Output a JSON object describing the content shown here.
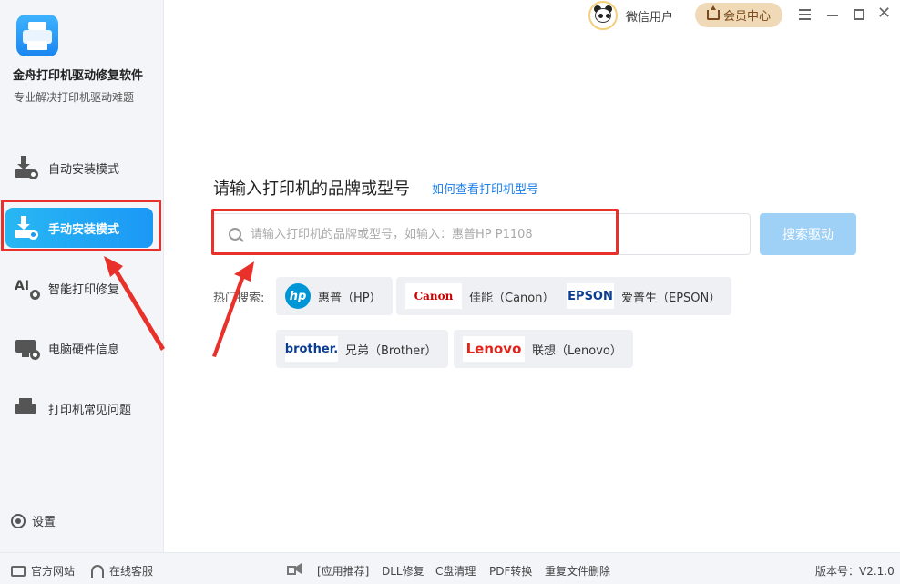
{
  "app": {
    "name": "金舟打印机驱动修复软件",
    "subtitle": "专业解决打印机驱动难题"
  },
  "sidebar": {
    "items": [
      {
        "label": "自动安装模式",
        "icon": "auto-install-icon",
        "active": false
      },
      {
        "label": "手动安装模式",
        "icon": "manual-install-icon",
        "active": true
      },
      {
        "label": "智能打印修复",
        "icon": "ai-repair-icon",
        "active": false
      },
      {
        "label": "电脑硬件信息",
        "icon": "hardware-info-icon",
        "active": false
      },
      {
        "label": "打印机常见问题",
        "icon": "printer-faq-icon",
        "active": false
      }
    ],
    "settings_label": "设置"
  },
  "header": {
    "username": "微信用户",
    "vip_label": "会员中心"
  },
  "main": {
    "title": "请输入打印机的品牌或型号",
    "help_link": "如何查看打印机型号",
    "search_placeholder": "请输入打印机的品牌或型号，如输入：惠普HP P1108",
    "search_value": "",
    "search_button": "搜索驱动",
    "hot_label": "热门搜索:",
    "hot_brands": [
      {
        "logo": "hp",
        "label": "惠普（HP）"
      },
      {
        "logo": "Canon",
        "label": "佳能（Canon）"
      },
      {
        "logo": "EPSON",
        "label": "爱普生（EPSON）"
      },
      {
        "logo": "brother.",
        "label": "兄弟（Brother）"
      },
      {
        "logo": "Lenovo",
        "label": "联想（Lenovo）"
      }
    ]
  },
  "footer": {
    "official_site": "官方网站",
    "online_support": "在线客服",
    "links": [
      "[应用推荐]",
      "DLL修复",
      "C盘清理",
      "PDF转换",
      "重复文件删除"
    ],
    "version": "版本号：V2.1.0"
  },
  "colors": {
    "accent": "#1b98f5",
    "annotation_red": "#e8312a",
    "vip_bg": "#f0d9b6"
  }
}
